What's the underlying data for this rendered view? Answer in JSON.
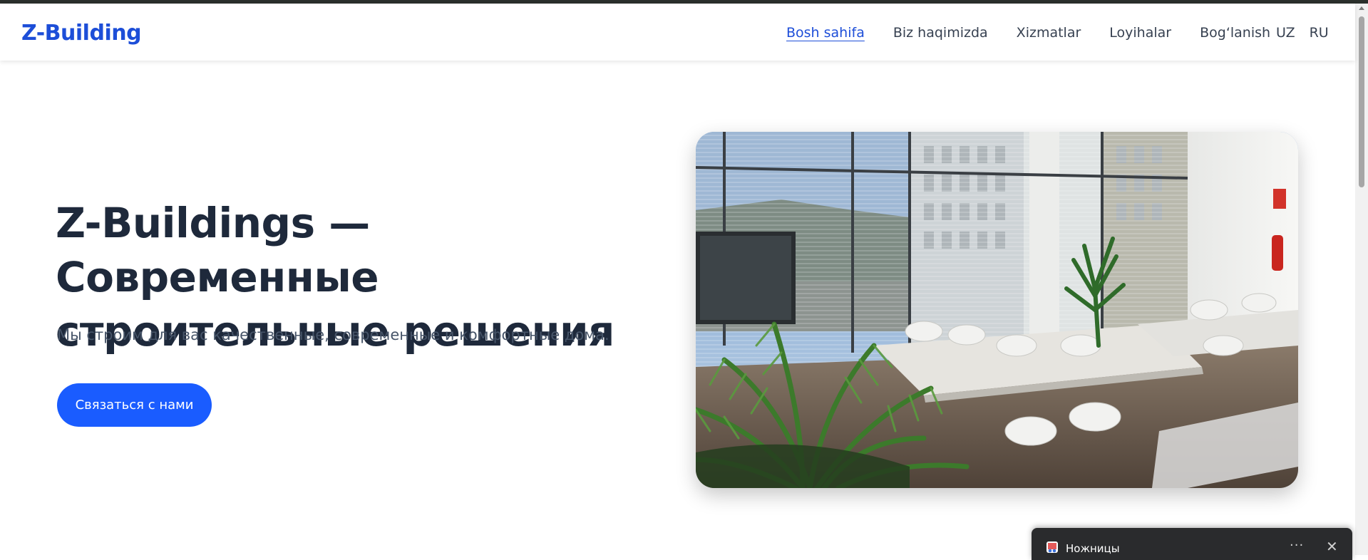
{
  "header": {
    "brand": "Z-Building",
    "nav": [
      {
        "label": "Bosh sahifa",
        "active": true
      },
      {
        "label": "Biz haqimizda",
        "active": false
      },
      {
        "label": "Xizmatlar",
        "active": false
      },
      {
        "label": "Loyihalar",
        "active": false
      },
      {
        "label": "Bog‘lanish",
        "active": false
      }
    ],
    "languages": [
      "UZ",
      "RU"
    ]
  },
  "hero": {
    "title": "Z-Buildings — Современные строительные решения",
    "subtitle": "Мы строим для вас качественные, современные и комфортные дома.",
    "cta_label": "Связаться с нами",
    "image_icon": "office-interior-photo"
  },
  "notification": {
    "title": "Ножницы",
    "icon": "snipping-tool-icon",
    "more_icon": "more-icon",
    "close_icon": "close-icon"
  },
  "colors": {
    "accent": "#1d4ed8",
    "button": "#1a5cff",
    "heading": "#1e293b",
    "text": "#475569",
    "toast_bg": "#2a2b2d"
  }
}
